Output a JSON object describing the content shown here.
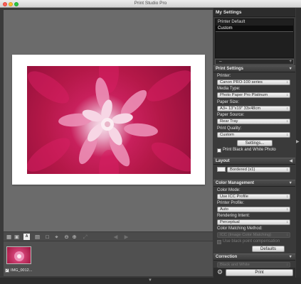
{
  "window": {
    "title": "Print Studio Pro"
  },
  "my_settings": {
    "header": "My Settings",
    "items": [
      "Printer Default",
      "Custom"
    ],
    "selected": "Custom",
    "add": "+",
    "remove": "–"
  },
  "print_settings": {
    "header": "Print Settings",
    "printer_label": "Printer:",
    "printer_value": "Canon PRO-100 series",
    "media_label": "Media Type:",
    "media_value": "Photo Paper Pro Platinum",
    "paper_size_label": "Paper Size:",
    "paper_size_value": "A3+ 13\"x19\" 33x48cm",
    "paper_source_label": "Paper Source:",
    "paper_source_value": "Rear Tray",
    "quality_label": "Print Quality:",
    "quality_value": "Custom",
    "settings_button": "Settings...",
    "bw_label": "Print Black and White Photo"
  },
  "layout": {
    "header": "Layout",
    "value": "Bordered (x1)"
  },
  "color_management": {
    "header": "Color Management",
    "color_mode_label": "Color Mode:",
    "color_mode_value": "Use ICC Profile",
    "printer_profile_label": "Printer Profile:",
    "printer_profile_value": "Auto",
    "rendering_label": "Rendering Intent:",
    "rendering_value": "Perceptual",
    "matching_label": "Color Matching Method:",
    "matching_value": "ICC (Image Color Matching)",
    "bpc_label": "Use black point compensation",
    "defaults_button": "Defaults"
  },
  "correction": {
    "header": "Correction",
    "value": "Black and White"
  },
  "print_button": "Print",
  "filmstrip": {
    "items": [
      {
        "label": "IMG_0012...",
        "checked": true
      }
    ]
  },
  "icons": {
    "toolbar": [
      "grid-view-icon",
      "fit-view-icon",
      "a-text-icon",
      "image-icon",
      "crop-icon",
      "zoom-out-icon",
      "zoom-in-icon",
      "expand-icon",
      "prev-icon",
      "next-icon"
    ],
    "bottom": [
      "chevron-down-icon"
    ],
    "panel": [
      "gear-icon"
    ]
  },
  "colors": {
    "accent_petal": "#c8205c",
    "paper": "#ffffff",
    "panel_bg": "#3a3a3a"
  }
}
